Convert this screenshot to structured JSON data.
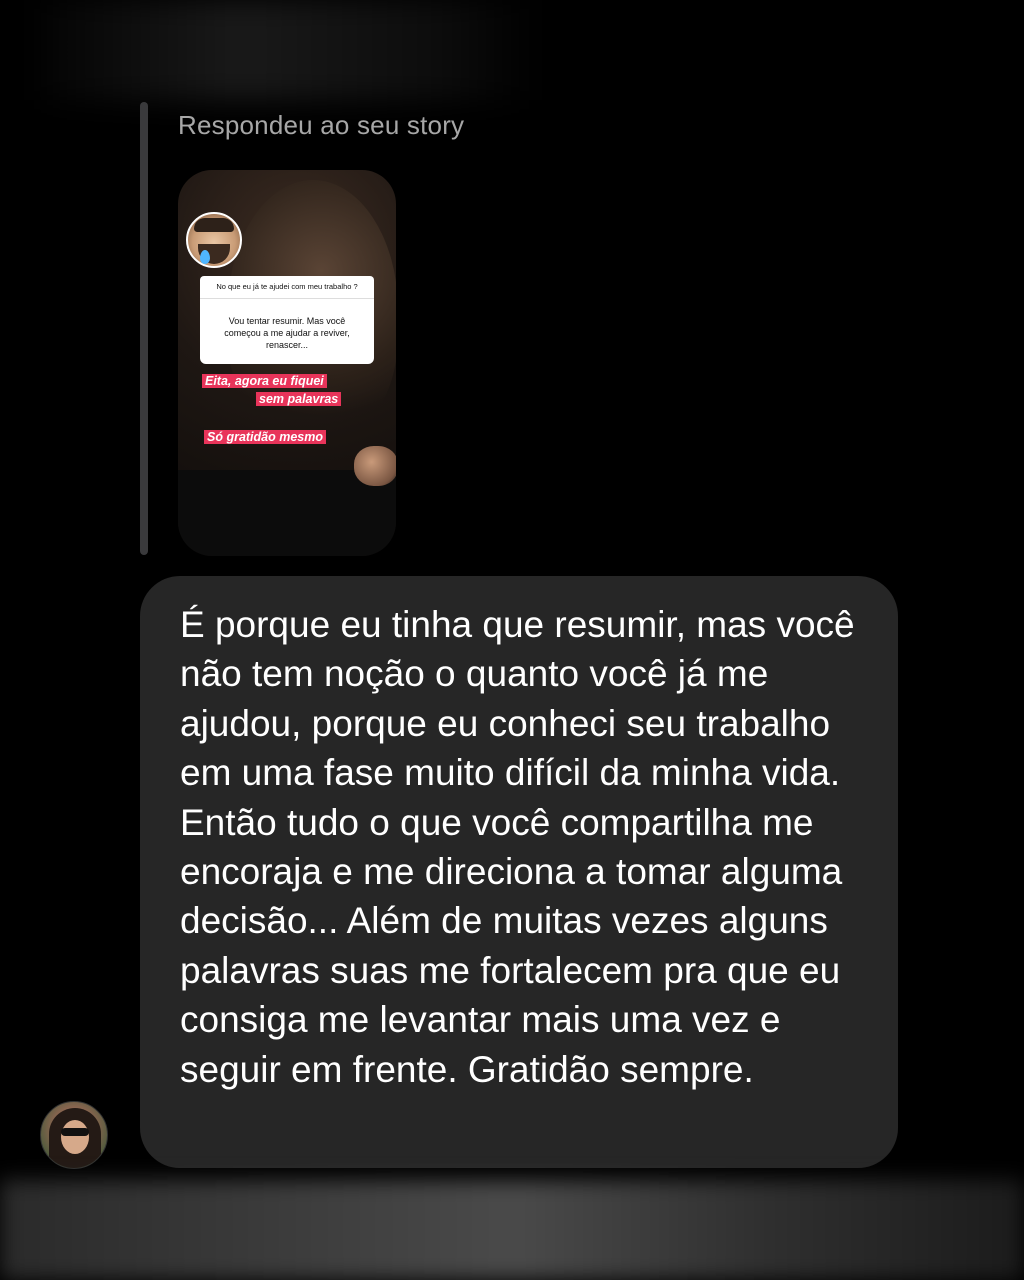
{
  "thread": {
    "reply_label": "Respondeu ao seu story"
  },
  "story_preview": {
    "question": "No que eu já te ajudei com meu trabalho ?",
    "answer": "Vou tentar resumir. Mas você começou a me ajudar a reviver, renascer...",
    "highlight_line1": "Eita, agora eu fiquei",
    "highlight_line2": "sem palavras",
    "highlight_line3": "Só gratidão mesmo",
    "highlight_color": "#e8345a"
  },
  "message": {
    "text": "É porque eu tinha que resumir, mas você não tem noção o quanto você já me ajudou, porque eu conheci seu trabalho em uma fase muito difícil da minha vida. Então tudo o que você compartilha me encoraja e me direciona a tomar alguma decisão... Além de muitas vezes alguns palavras suas me fortalecem pra que eu consiga me levantar mais uma vez e seguir em frente. Gratidão sempre.",
    "bubble_color": "#262626"
  },
  "sender": {
    "avatar_icon": "profile-photo"
  }
}
